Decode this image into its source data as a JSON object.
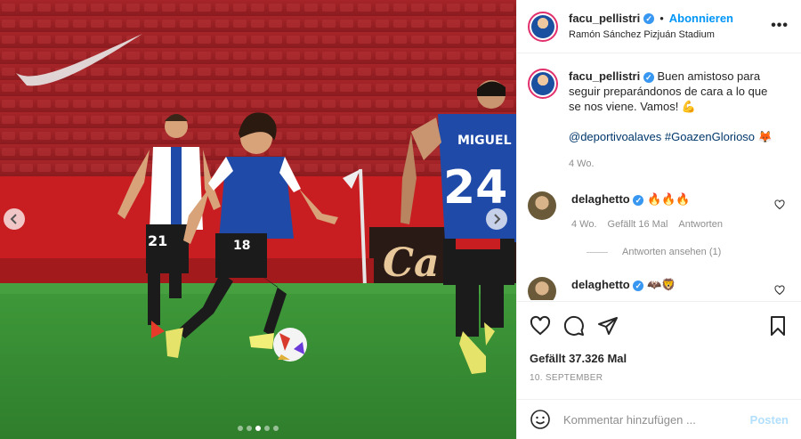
{
  "post": {
    "username": "facu_pellistri",
    "follow_label": "Abonnieren",
    "location": "Ramón Sánchez Pizjuán Stadium",
    "more_label": "•••",
    "caption_text": "Buen amistoso para seguir preparándonos de cara a lo que se nos viene. Vamos! 💪",
    "caption_tags": "@deportivoalaves #GoazenGlorioso 🦊",
    "caption_time": "4 Wo.",
    "likes": "Gefällt 37.326 Mal",
    "date": "10. SEPTEMBER",
    "comment_placeholder": "Kommentar hinzufügen ...",
    "post_label": "Posten"
  },
  "comments": [
    {
      "username": "delaghetto",
      "text": "🔥🔥🔥",
      "time": "4 Wo.",
      "likes": "Gefällt 16 Mal",
      "reply_label": "Antworten",
      "view_replies": "Antworten ansehen (1)"
    },
    {
      "username": "delaghetto",
      "text": "🦇🦁"
    }
  ],
  "photo": {
    "player_front_number": "18",
    "player_left_number": "21",
    "player_back_number": "24",
    "player_back_name": "MIGUEL",
    "banner_text": "Ca",
    "carousel_total": 5,
    "carousel_active": 2
  },
  "colors": {
    "accent": "#0095f6",
    "verified": "#3897f0",
    "muted": "#8e8e8e",
    "jersey_blue": "#1f4aa8"
  }
}
